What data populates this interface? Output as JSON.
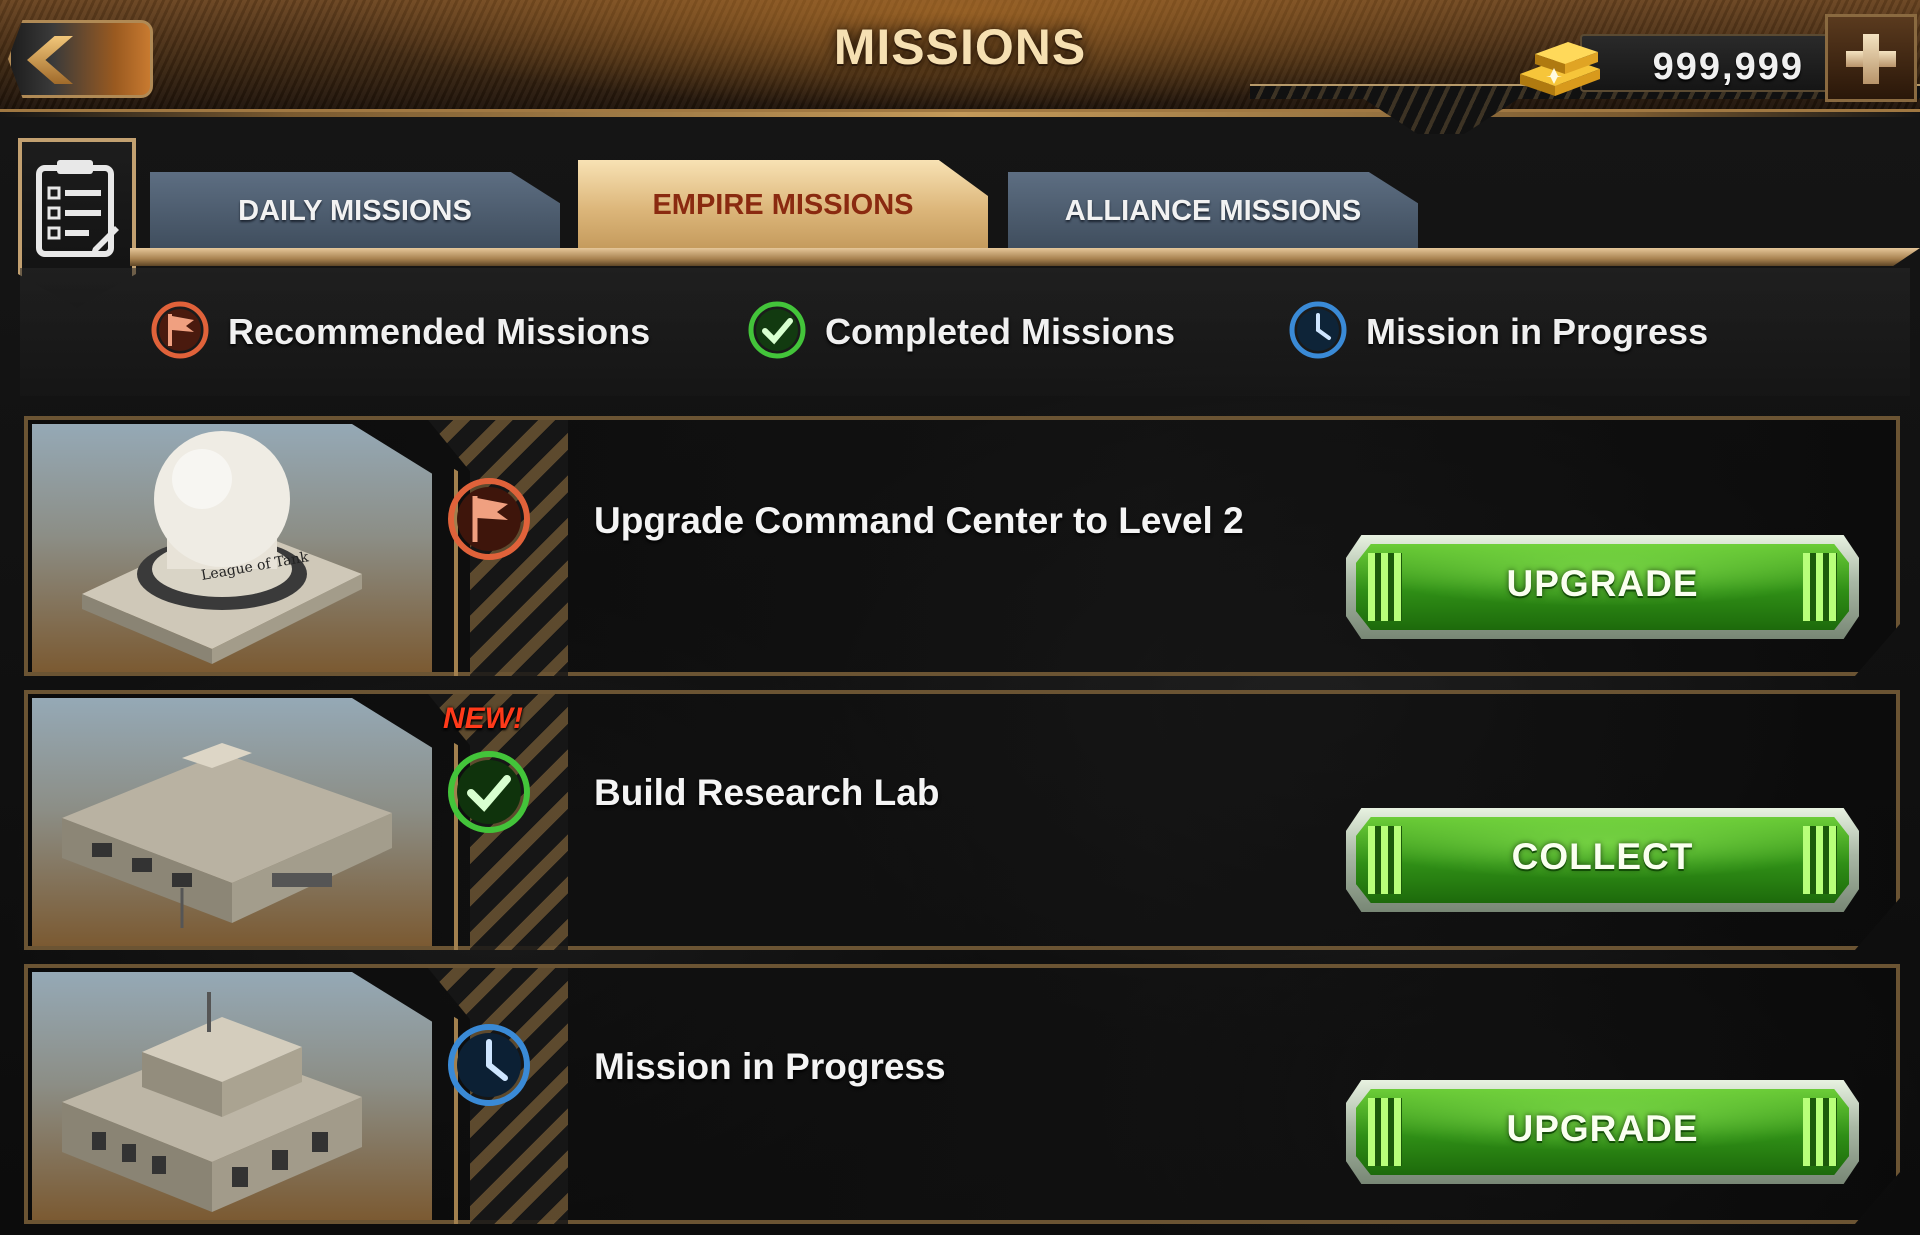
{
  "header": {
    "title": "MISSIONS",
    "back_icon": "chevron-left-icon",
    "currency": {
      "amount": "999,999",
      "icon": "gold-bars-icon"
    },
    "add_icon": "plus-icon"
  },
  "tabs": [
    {
      "label": "DAILY MISSIONS",
      "active": false
    },
    {
      "label": "EMPIRE MISSIONS",
      "active": true
    },
    {
      "label": "ALLIANCE MISSIONS",
      "active": false
    }
  ],
  "legend": [
    {
      "label": "Recommended Missions",
      "icon": "flag-icon",
      "color": "#e0623a"
    },
    {
      "label": "Completed Missions",
      "icon": "checkmark-icon",
      "color": "#43c43a"
    },
    {
      "label": "Mission in Progress",
      "icon": "clock-icon",
      "color": "#3a8ad6"
    }
  ],
  "missions": [
    {
      "title": "Upgrade Command Center to Level 2",
      "status": "recommended",
      "status_icon": "flag-icon",
      "thumbnail": "command-center-dome-icon",
      "thumbnail_text": "League of Tank",
      "new": false,
      "button": "UPGRADE"
    },
    {
      "title": "Build Research Lab",
      "status": "completed",
      "status_icon": "checkmark-icon",
      "thumbnail": "research-lab-icon",
      "new": true,
      "new_label": "NEW!",
      "button": "COLLECT"
    },
    {
      "title": "Mission in Progress",
      "status": "in-progress",
      "status_icon": "clock-icon",
      "thumbnail": "barracks-building-icon",
      "new": false,
      "button": "UPGRADE"
    }
  ],
  "colors": {
    "accent_gold": "#c49a5c",
    "active_tab_text": "#8a2a10",
    "inactive_tab": "#4f5e70",
    "button_green": "#2f8e16",
    "new_badge": "#ff3a1a"
  }
}
